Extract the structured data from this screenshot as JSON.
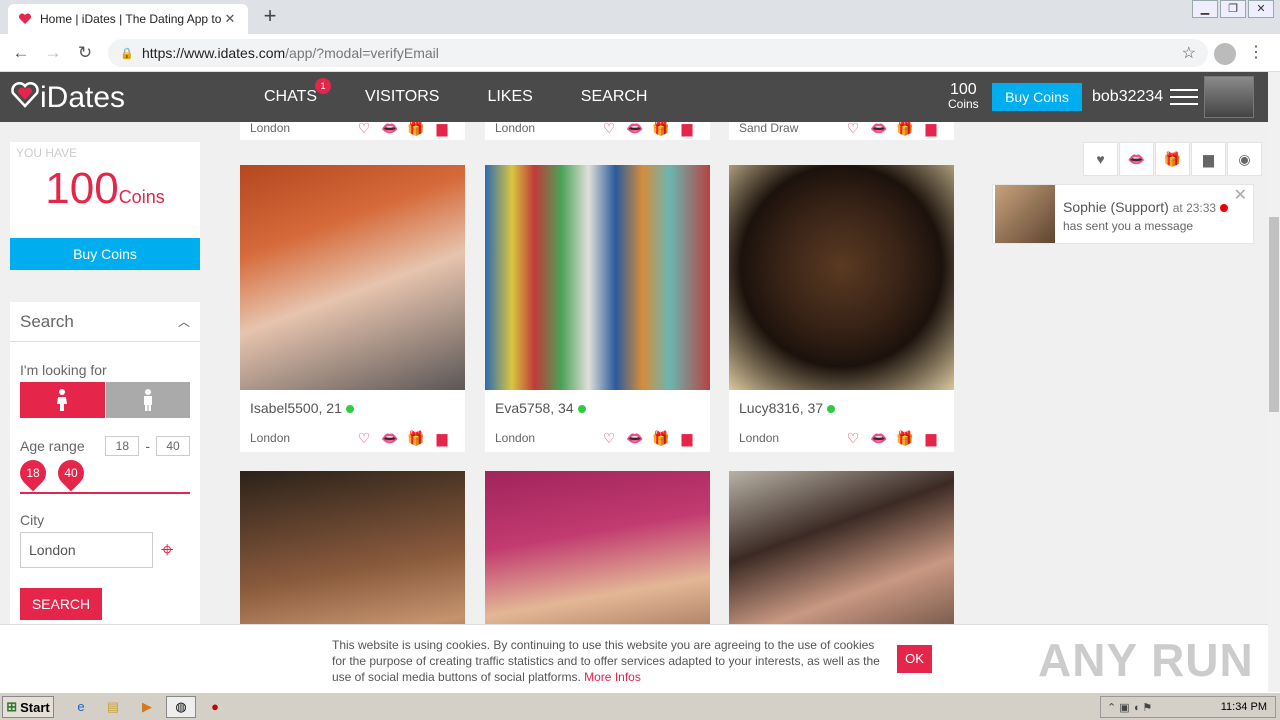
{
  "browser": {
    "tab_title": "Home | iDates | The Dating App to fl",
    "url_host": "https://www.idates.com",
    "url_path": "/app/?modal=verifyEmail"
  },
  "header": {
    "logo": "iDates",
    "nav": [
      "CHATS",
      "VISITORS",
      "LIKES",
      "SEARCH"
    ],
    "chats_badge": "1",
    "coins_num": "100",
    "coins_label": "Coins",
    "buy_coins": "Buy Coins",
    "username": "bob32234"
  },
  "coins_box": {
    "you_have": "YOU HAVE",
    "amount": "100",
    "unit": "Coins",
    "buy": "Buy Coins"
  },
  "search": {
    "title": "Search",
    "looking_for": "I'm looking for",
    "age_range": "Age range",
    "age_min": "18",
    "age_max": "40",
    "city_label": "City",
    "city_value": "London",
    "button": "SEARCH"
  },
  "top_strip": [
    {
      "city": "London"
    },
    {
      "city": "London"
    },
    {
      "city": "Sand Draw"
    }
  ],
  "profiles": [
    {
      "name": "Isabel5500, 21",
      "city": "London"
    },
    {
      "name": "Eva5758, 34",
      "city": "London"
    },
    {
      "name": "Lucy8316, 37",
      "city": "London"
    }
  ],
  "notification": {
    "from": "Sophie (Support)",
    "time": "at 23:33",
    "message": "has sent you a message"
  },
  "cookie": {
    "text": "This website is using cookies. By continuing to use this website you are agreeing to the use of cookies for the purpose of creating traffic statistics and to offer services adapted to your interests, as well as the use of social media buttons of social platforms.",
    "more": "More Infos",
    "ok": "OK"
  },
  "watermark": "ANY RUN",
  "taskbar": {
    "start": "Start",
    "clock": "11:34 PM"
  },
  "colors": {
    "brand": "#e5254a",
    "accent": "#00aeef",
    "header_bg": "#4a4a4a"
  }
}
